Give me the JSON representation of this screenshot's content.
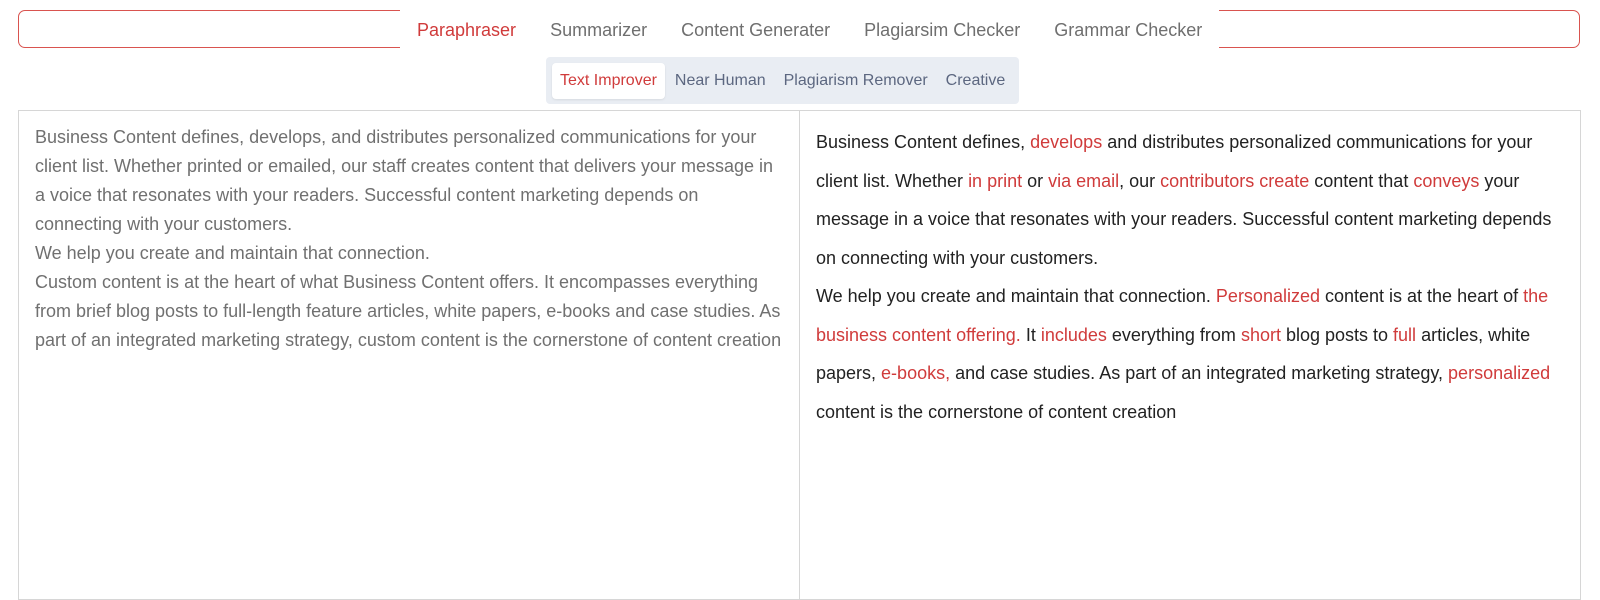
{
  "main_tabs": [
    {
      "label": "Paraphraser",
      "active": true
    },
    {
      "label": "Summarizer",
      "active": false
    },
    {
      "label": "Content Generater",
      "active": false
    },
    {
      "label": "Plagiarsim Checker",
      "active": false
    },
    {
      "label": "Grammar Checker",
      "active": false
    }
  ],
  "modes": [
    {
      "label": "Text Improver",
      "active": true
    },
    {
      "label": "Near Human",
      "active": false
    },
    {
      "label": "Plagiarism Remover",
      "active": false
    },
    {
      "label": "Creative",
      "active": false
    }
  ],
  "input": {
    "text": "Business Content defines, develops, and distributes personalized communications for your client list. Whether printed or emailed, our staff creates content that delivers your message in a voice that resonates with your readers. Successful content marketing depends on connecting with your customers.\nWe help you create and maintain that connection.\nCustom content is at the heart of what Business Content offers. It encompasses everything from brief blog posts to full-length feature articles, white papers, e-books and case studies. As part of an integrated marketing strategy, custom content is the cornerstone of content creation"
  },
  "output": {
    "segments": [
      {
        "text": "Business Content defines, ",
        "changed": false
      },
      {
        "text": "develops",
        "changed": true
      },
      {
        "text": " and distributes personalized communications for your client list. Whether ",
        "changed": false
      },
      {
        "text": "in print",
        "changed": true
      },
      {
        "text": " or ",
        "changed": false
      },
      {
        "text": "via email",
        "changed": true
      },
      {
        "text": ", our ",
        "changed": false
      },
      {
        "text": "contributors create",
        "changed": true
      },
      {
        "text": " content that ",
        "changed": false
      },
      {
        "text": "conveys",
        "changed": true
      },
      {
        "text": " your message in a voice that resonates with your readers. Successful content marketing depends on connecting with your customers.",
        "changed": false
      },
      {
        "break": true
      },
      {
        "text": "We help you create and maintain that connection. ",
        "changed": false
      },
      {
        "text": "Personalized",
        "changed": true
      },
      {
        "text": " content is at the heart of ",
        "changed": false
      },
      {
        "text": "the business content offering.",
        "changed": true
      },
      {
        "text": " It ",
        "changed": false
      },
      {
        "text": "includes",
        "changed": true
      },
      {
        "text": " everything from ",
        "changed": false
      },
      {
        "text": "short",
        "changed": true
      },
      {
        "text": " blog posts to ",
        "changed": false
      },
      {
        "text": "full",
        "changed": true
      },
      {
        "text": " articles, white papers, ",
        "changed": false
      },
      {
        "text": "e-books,",
        "changed": true
      },
      {
        "text": " and case studies. As part of an integrated marketing strategy, ",
        "changed": false
      },
      {
        "text": "personalized",
        "changed": true
      },
      {
        "text": " content is the cornerstone of content creation",
        "changed": false
      }
    ]
  },
  "colors": {
    "accent": "#d03b3b",
    "tab_text": "#6f6f6f",
    "mode_bar_bg": "#e9edf3",
    "input_text": "#707070",
    "output_text": "#222222",
    "panel_border": "#d6d6d6"
  }
}
